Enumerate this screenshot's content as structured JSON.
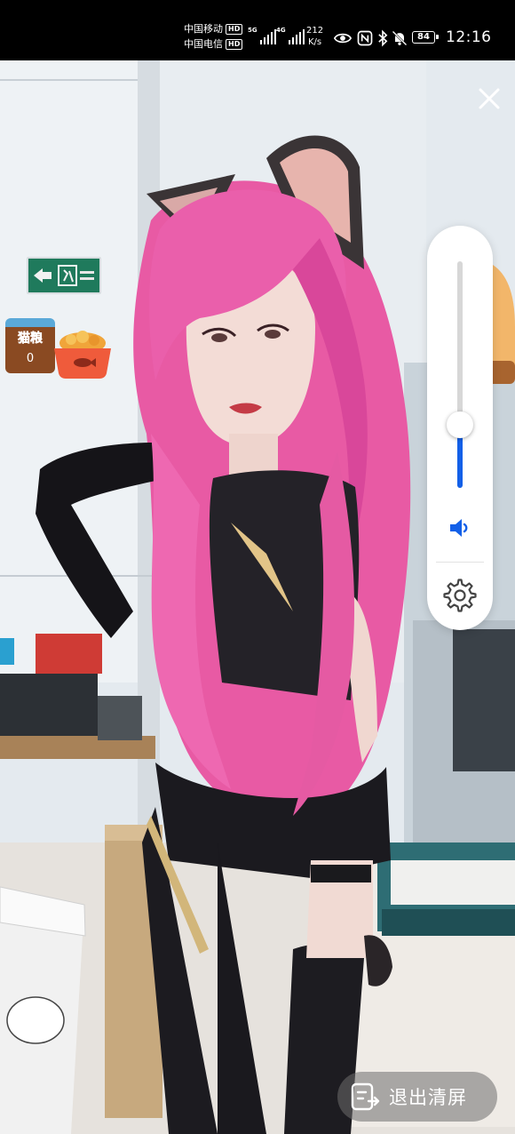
{
  "status_bar": {
    "carrier_1": "中国移动",
    "carrier_2": "中国电信",
    "hd_label": "HD",
    "signal_1_gen": "5G",
    "signal_2_gen": "4G",
    "net_speed_value": "212",
    "net_speed_unit": "K/s",
    "battery_level": "84",
    "time": "12:16"
  },
  "overlay": {
    "badge_label": "猫粮",
    "badge_count": "0",
    "exit_clear_label": "退出清屏"
  },
  "volume": {
    "level": 0.28,
    "fill_color": "#1360e8"
  },
  "icons": {
    "close": "close-icon",
    "speaker": "speaker-icon",
    "settings": "gear-icon",
    "exit_clear": "exit-clear-icon"
  }
}
